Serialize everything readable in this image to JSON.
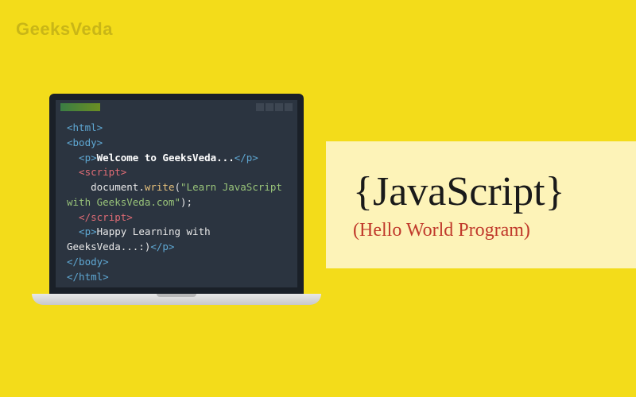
{
  "logo": "GeeksVeda",
  "title": {
    "main": "{JavaScript}",
    "sub": "(Hello World Program)"
  },
  "code": {
    "l1": "<html>",
    "l2": "<body>",
    "l3a": "  <p>",
    "l3b": "Welcome to GeeksVeda...",
    "l3c": "</p>",
    "l4": "  <script>",
    "l5a": "    document",
    "l5b": ".",
    "l5c": "write",
    "l5d": "(",
    "l5e": "\"Learn JavaScript",
    "l6a": "with GeeksVeda.com\"",
    "l6b": ");",
    "l7": "  </scr",
    "l7b": "ipt>",
    "l8a": "  <p>",
    "l8b": "Happy Learning with",
    "l9a": "GeeksVeda...:)",
    "l9b": "</p>",
    "l10": "</body>",
    "l11": "</html>"
  }
}
